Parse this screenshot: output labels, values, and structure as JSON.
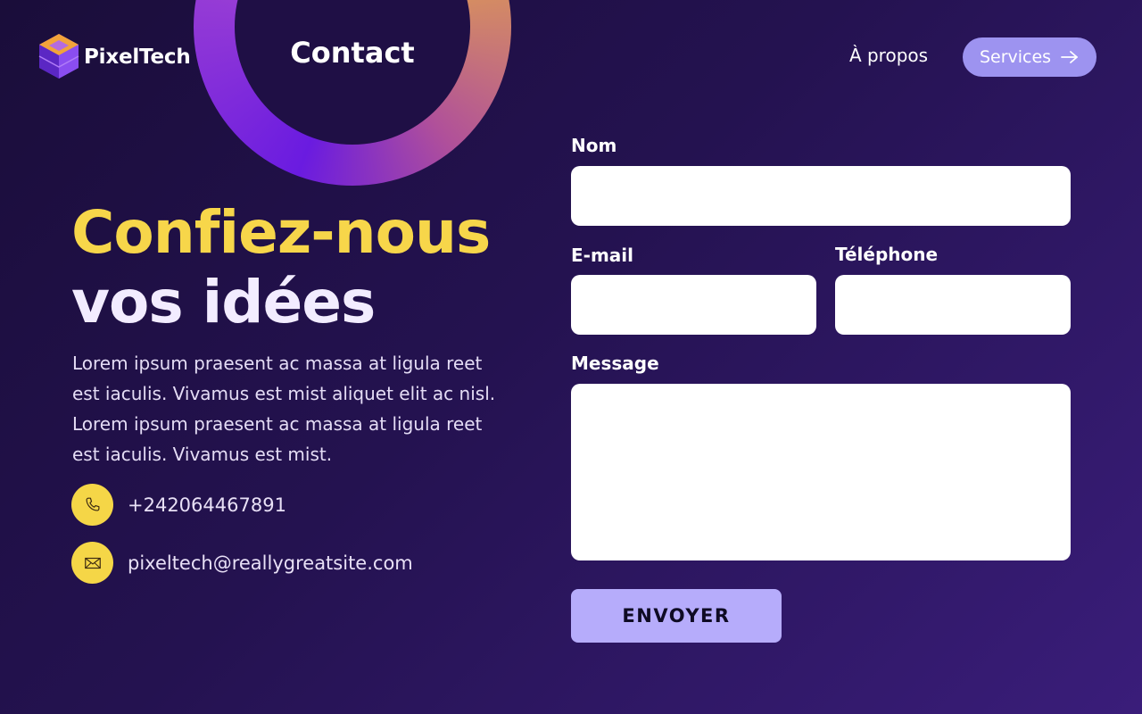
{
  "brand": {
    "name": "PixelTech",
    "icon": "cube-logo-icon"
  },
  "nav": {
    "title": "Contact",
    "links": [
      {
        "label": "À propos"
      },
      {
        "label": "Services",
        "icon": "arrow-right-icon"
      }
    ]
  },
  "hero": {
    "headline_line1": "Confiez-nous",
    "headline_line2": "vos idées",
    "description": "Lorem ipsum praesent ac massa at ligula reet est iaculis. Vivamus est mist aliquet elit ac nisl. Lorem ipsum praesent ac massa at ligula reet est iaculis. Vivamus est mist."
  },
  "contact": {
    "phone": {
      "value": "+242064467891",
      "icon": "phone-icon"
    },
    "email": {
      "value": "pixeltech@reallygreatsite.com",
      "icon": "envelope-icon"
    }
  },
  "form": {
    "name_label": "Nom",
    "name_value": "",
    "email_label": "E-mail",
    "email_value": "",
    "phone_label": "Téléphone",
    "phone_value": "",
    "message_label": "Message",
    "message_value": "",
    "submit_label": "ENVOYER"
  },
  "colors": {
    "background_dark": "#1a0d3a",
    "background_light": "#3a1d7a",
    "accent_yellow": "#f7d64a",
    "button_lavender": "#b6acfb",
    "services_button": "#9d93f0"
  }
}
